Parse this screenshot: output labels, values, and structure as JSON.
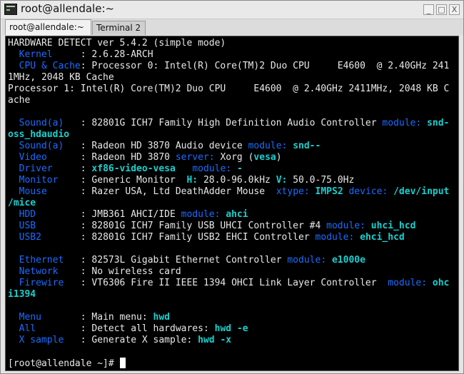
{
  "window": {
    "title": "root@allendale:~",
    "controls": {
      "minimize": "_",
      "maximize": "□",
      "close": "X"
    }
  },
  "tabs": [
    {
      "label": "root@allendale:~",
      "active": true
    },
    {
      "label": "Terminal 2",
      "active": false
    }
  ],
  "terminal": {
    "header": "HARDWARE DETECT ver 5.4.2 (simple mode)",
    "kernel": {
      "label": "Kernel",
      "value": "2.6.28-ARCH"
    },
    "cpu": {
      "label": "CPU & Cache",
      "line1": "Processor 0: Intel(R) Core(TM)2 Duo CPU     E4600  @ 2.40GHz 241",
      "line2": "1MHz, 2048 KB Cache",
      "line3": "Processor 1: Intel(R) Core(TM)2 Duo CPU     E4600  @ 2.40GHz 2411MHz, 2048 KB C",
      "line4": "ache"
    },
    "sound_a1": {
      "label": "Sound(a)",
      "value": "82801G ICH7 Family High Definition Audio Controller",
      "kw": "module:",
      "module": "snd-",
      "cont": "oss_hdaudio"
    },
    "sound_a2": {
      "label": "Sound(a)",
      "value": "Radeon HD 3870 Audio device",
      "kw": "module:",
      "module": "snd--"
    },
    "video": {
      "label": "Video",
      "value": "Radeon HD 3870",
      "kw": "server:",
      "kwv": "Xorg (",
      "module": "vesa",
      "tail": ")"
    },
    "driver": {
      "label": "Driver",
      "value": "xf86-video-vesa",
      "kw": "module:",
      "module": "-"
    },
    "monitor": {
      "label": "Monitor",
      "value": "Generic Monitor",
      "h": "H:",
      "hv": "28.0-96.0kHz",
      "v": "V:",
      "vv": "50.0-75.0Hz"
    },
    "mouse": {
      "label": "Mouse",
      "value": "Razer USA, Ltd DeathAdder Mouse",
      "kw1": "xtype:",
      "v1": "IMPS2",
      "kw2": "device:",
      "v2": "/dev/input",
      "cont": "/mice"
    },
    "hdd": {
      "label": "HDD",
      "value": "JMB361 AHCI/IDE",
      "kw": "module:",
      "module": "ahci"
    },
    "usb": {
      "label": "USB",
      "value": "82801G ICH7 Family USB UHCI Controller #4",
      "kw": "module:",
      "module": "uhci_hcd"
    },
    "usb2": {
      "label": "USB2",
      "value": "82801G ICH7 Family USB2 EHCI Controller",
      "kw": "module:",
      "module": "ehci_hcd"
    },
    "ethernet": {
      "label": "Ethernet",
      "value": "82573L Gigabit Ethernet Controller",
      "kw": "module:",
      "module": "e1000e"
    },
    "network": {
      "label": "Network",
      "value": "No wireless card"
    },
    "firewire": {
      "label": "Firewire",
      "value": "VT6306 Fire II IEEE 1394 OHCI Link Layer Controller",
      "kw": "module:",
      "module": "ohc",
      "cont": "i1394"
    },
    "menu": {
      "label": "Menu",
      "value": "Main menu:",
      "cmd": "hwd"
    },
    "all": {
      "label": "All",
      "value": "Detect all hardwares:",
      "cmd": "hwd -e"
    },
    "xsample": {
      "label": "X sample",
      "value": "Generate X sample:",
      "cmd": "hwd -x"
    },
    "prompt": "[root@allendale ~]#"
  },
  "colors": {
    "terminal_bg": "#000000",
    "text": "#e8e8e8",
    "label_blue": "#1a6cff",
    "value_cyan": "#19d0d0"
  }
}
